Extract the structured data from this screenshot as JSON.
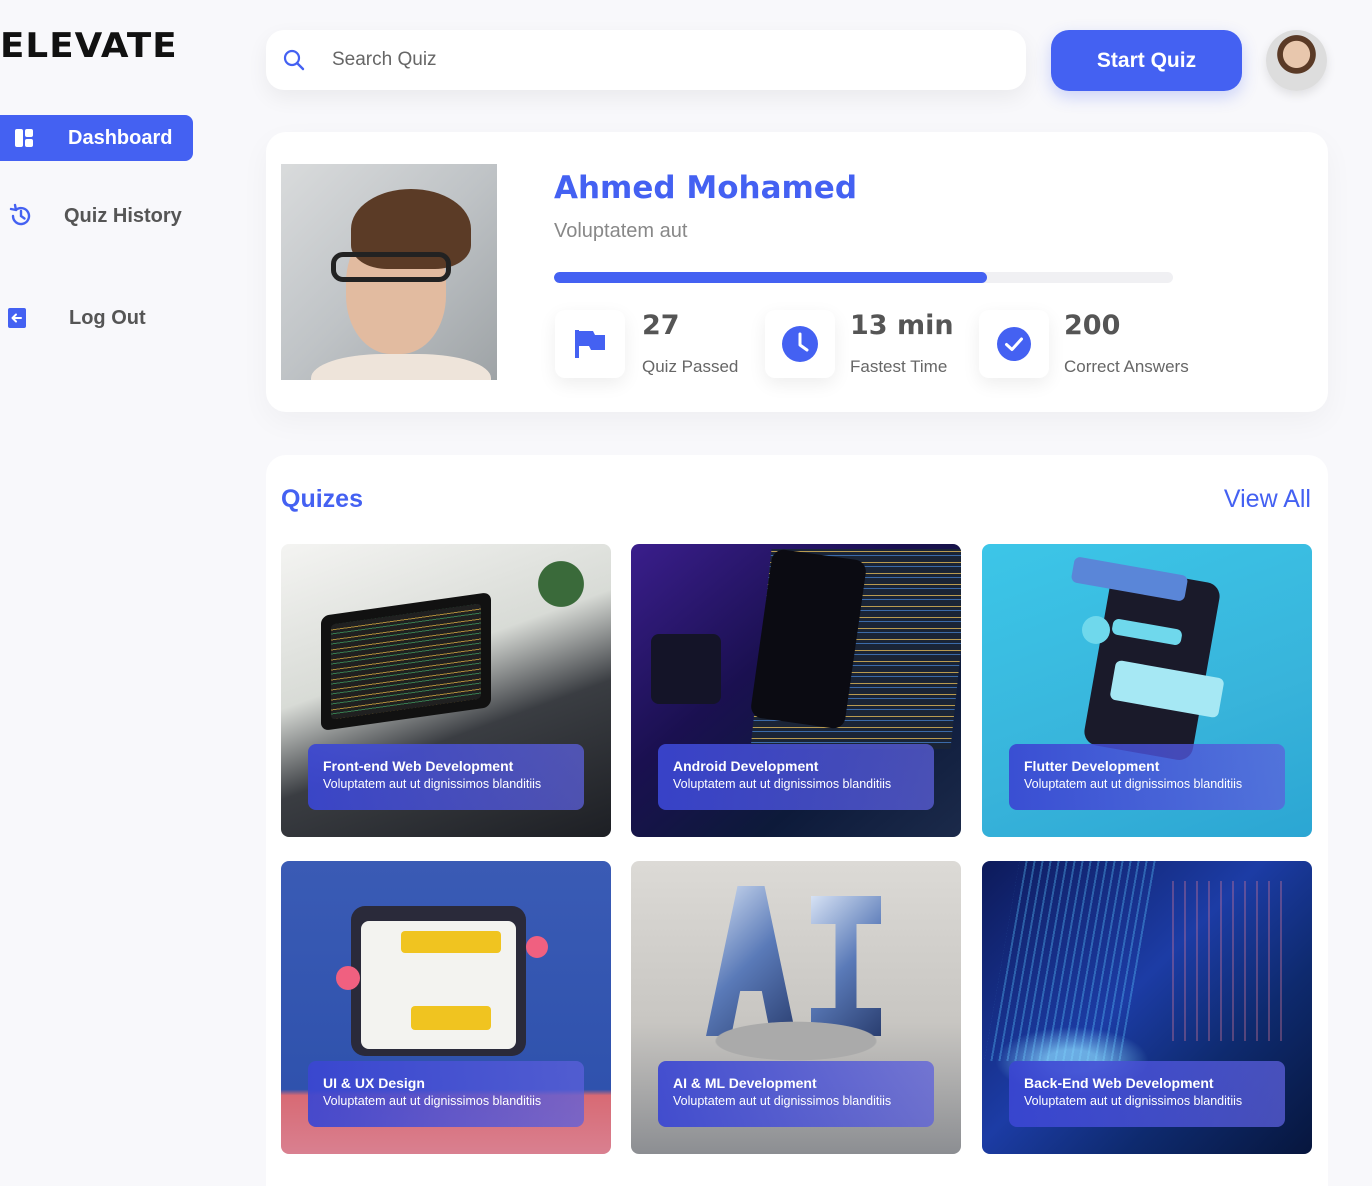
{
  "app": {
    "logo": "ELEVATE"
  },
  "sidebar": {
    "items": [
      {
        "label": "Dashboard",
        "icon": "dashboard-icon",
        "active": true
      },
      {
        "label": "Quiz History",
        "icon": "history-icon",
        "active": false
      },
      {
        "label": "Log Out",
        "icon": "logout-icon",
        "active": false
      }
    ]
  },
  "header": {
    "search_placeholder": "Search Quiz",
    "start_button": "Start Quiz"
  },
  "profile": {
    "name": "Ahmed Mohamed",
    "subtitle": "Voluptatem aut",
    "progress_fraction": 0.7,
    "stats": [
      {
        "value": "27",
        "label": "Quiz Passed",
        "icon": "flag-icon"
      },
      {
        "value": "13 min",
        "label": "Fastest Time",
        "icon": "clock-icon"
      },
      {
        "value": "200",
        "label": "Correct Answers",
        "icon": "check-circle-icon"
      }
    ]
  },
  "quizzes": {
    "title": "Quizes",
    "view_all": "View All",
    "cards": [
      {
        "title": "Front-end Web Development",
        "desc": "Voluptatem aut ut dignissimos blanditiis"
      },
      {
        "title": "Android Development",
        "desc": "Voluptatem aut ut dignissimos blanditiis"
      },
      {
        "title": "Flutter Development",
        "desc": "Voluptatem aut ut dignissimos blanditiis"
      },
      {
        "title": "UI & UX Design",
        "desc": "Voluptatem aut ut dignissimos blanditiis"
      },
      {
        "title": "AI & ML Development",
        "desc": "Voluptatem aut ut dignissimos blanditiis"
      },
      {
        "title": "Back-End Web Development",
        "desc": "Voluptatem aut ut dignissimos blanditiis"
      }
    ]
  },
  "colors": {
    "accent": "#4461f2",
    "text_muted": "#888888"
  }
}
